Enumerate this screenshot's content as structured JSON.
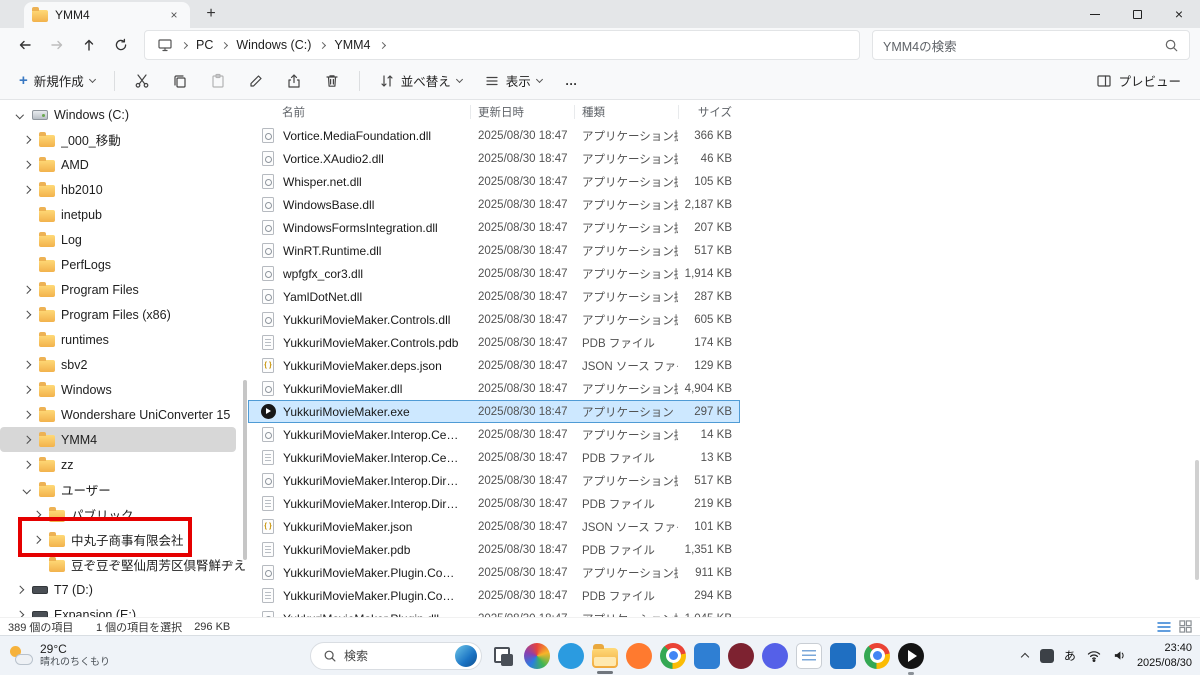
{
  "window": {
    "tab_title": "YMM4",
    "breadcrumb": [
      "PC",
      "Windows (C:)",
      "YMM4"
    ],
    "search_placeholder": "YMM4の検索"
  },
  "toolbar": {
    "new_label": "新規作成",
    "sort_label": "並べ替え",
    "view_label": "表示",
    "more_label": "…",
    "preview_label": "プレビュー"
  },
  "columns": [
    "名前",
    "更新日時",
    "種類",
    "サイズ"
  ],
  "sidebar": {
    "items": [
      {
        "id": "windows-c",
        "label": "Windows (C:)",
        "level": 0,
        "chevron": "down",
        "icon": "drive"
      },
      {
        "id": "000-idou",
        "label": "_000_移動",
        "level": 1,
        "chevron": "right",
        "icon": "folder"
      },
      {
        "id": "amd",
        "label": "AMD",
        "level": 1,
        "chevron": "right",
        "icon": "folder"
      },
      {
        "id": "hb2010",
        "label": "hb2010",
        "level": 1,
        "chevron": "right",
        "icon": "folder"
      },
      {
        "id": "inetpub",
        "label": "inetpub",
        "level": 1,
        "chevron": "none",
        "icon": "folder"
      },
      {
        "id": "log",
        "label": "Log",
        "level": 1,
        "chevron": "none",
        "icon": "folder"
      },
      {
        "id": "perflogs",
        "label": "PerfLogs",
        "level": 1,
        "chevron": "none",
        "icon": "folder"
      },
      {
        "id": "program-files",
        "label": "Program Files",
        "level": 1,
        "chevron": "right",
        "icon": "folder"
      },
      {
        "id": "program-files-x86",
        "label": "Program Files (x86)",
        "level": 1,
        "chevron": "right",
        "icon": "folder"
      },
      {
        "id": "runtimes",
        "label": "runtimes",
        "level": 1,
        "chevron": "none",
        "icon": "folder"
      },
      {
        "id": "sbv2",
        "label": "sbv2",
        "level": 1,
        "chevron": "right",
        "icon": "folder"
      },
      {
        "id": "windows",
        "label": "Windows",
        "level": 1,
        "chevron": "right",
        "icon": "folder"
      },
      {
        "id": "wondershare-uniconverter-15",
        "label": "Wondershare UniConverter 15",
        "level": 1,
        "chevron": "right",
        "icon": "folder"
      },
      {
        "id": "ymm4",
        "label": "YMM4",
        "level": 1,
        "chevron": "right",
        "icon": "folder",
        "selected": true
      },
      {
        "id": "zz",
        "label": "zz",
        "level": 1,
        "chevron": "right",
        "icon": "folder"
      },
      {
        "id": "users",
        "label": "ユーザー",
        "level": 1,
        "chevron": "down",
        "icon": "folder"
      },
      {
        "id": "public",
        "label": "パブリック",
        "level": 2,
        "chevron": "right",
        "icon": "folder"
      },
      {
        "id": "nakamaruko-shoji",
        "label": "中丸子商事有限会社",
        "level": 2,
        "chevron": "right",
        "icon": "folder",
        "annotated": true
      },
      {
        "id": "mojibake-user-folder",
        "label": "豆ぞ豆ぞ堅仙周芳区倶腎鮮ヂえ",
        "level": 2,
        "chevron": "none",
        "icon": "folder"
      },
      {
        "id": "t7-d",
        "label": "T7 (D:)",
        "level": 0,
        "chevron": "right",
        "icon": "drive-dark"
      },
      {
        "id": "expansion-e",
        "label": "Expansion (E:)",
        "level": 0,
        "chevron": "right",
        "icon": "drive-dark"
      }
    ]
  },
  "files": [
    {
      "name": "Vortice.MediaFoundation.dll",
      "modified": "2025/08/30 18:47",
      "type": "アプリケーション拡張",
      "size": "366 KB",
      "icon": "dll"
    },
    {
      "name": "Vortice.XAudio2.dll",
      "modified": "2025/08/30 18:47",
      "type": "アプリケーション拡張",
      "size": "46 KB",
      "icon": "dll"
    },
    {
      "name": "Whisper.net.dll",
      "modified": "2025/08/30 18:47",
      "type": "アプリケーション拡張",
      "size": "105 KB",
      "icon": "dll"
    },
    {
      "name": "WindowsBase.dll",
      "modified": "2025/08/30 18:47",
      "type": "アプリケーション拡張",
      "size": "2,187 KB",
      "icon": "dll"
    },
    {
      "name": "WindowsFormsIntegration.dll",
      "modified": "2025/08/30 18:47",
      "type": "アプリケーション拡張",
      "size": "207 KB",
      "icon": "dll"
    },
    {
      "name": "WinRT.Runtime.dll",
      "modified": "2025/08/30 18:47",
      "type": "アプリケーション拡張",
      "size": "517 KB",
      "icon": "dll"
    },
    {
      "name": "wpfgfx_cor3.dll",
      "modified": "2025/08/30 18:47",
      "type": "アプリケーション拡張",
      "size": "1,914 KB",
      "icon": "dll"
    },
    {
      "name": "YamlDotNet.dll",
      "modified": "2025/08/30 18:47",
      "type": "アプリケーション拡張",
      "size": "287 KB",
      "icon": "dll"
    },
    {
      "name": "YukkuriMovieMaker.Controls.dll",
      "modified": "2025/08/30 18:47",
      "type": "アプリケーション拡張",
      "size": "605 KB",
      "icon": "dll"
    },
    {
      "name": "YukkuriMovieMaker.Controls.pdb",
      "modified": "2025/08/30 18:47",
      "type": "PDB ファイル",
      "size": "174 KB",
      "icon": "pdb"
    },
    {
      "name": "YukkuriMovieMaker.deps.json",
      "modified": "2025/08/30 18:47",
      "type": "JSON ソース ファイル",
      "size": "129 KB",
      "icon": "json"
    },
    {
      "name": "YukkuriMovieMaker.dll",
      "modified": "2025/08/30 18:47",
      "type": "アプリケーション拡張",
      "size": "4,904 KB",
      "icon": "dll"
    },
    {
      "name": "YukkuriMovieMaker.exe",
      "modified": "2025/08/30 18:47",
      "type": "アプリケーション",
      "size": "297 KB",
      "icon": "exe",
      "selected": true
    },
    {
      "name": "YukkuriMovieMaker.Interop.CeVIO.dll",
      "modified": "2025/08/30 18:47",
      "type": "アプリケーション拡張",
      "size": "14 KB",
      "icon": "dll"
    },
    {
      "name": "YukkuriMovieMaker.Interop.CeVIO.pdb",
      "modified": "2025/08/30 18:47",
      "type": "PDB ファイル",
      "size": "13 KB",
      "icon": "pdb"
    },
    {
      "name": "YukkuriMovieMaker.Interop.DirectShow.dll",
      "modified": "2025/08/30 18:47",
      "type": "アプリケーション拡張",
      "size": "517 KB",
      "icon": "dll"
    },
    {
      "name": "YukkuriMovieMaker.Interop.DirectShow.p...",
      "modified": "2025/08/30 18:47",
      "type": "PDB ファイル",
      "size": "219 KB",
      "icon": "pdb"
    },
    {
      "name": "YukkuriMovieMaker.json",
      "modified": "2025/08/30 18:47",
      "type": "JSON ソース ファイル",
      "size": "101 KB",
      "icon": "json"
    },
    {
      "name": "YukkuriMovieMaker.pdb",
      "modified": "2025/08/30 18:47",
      "type": "PDB ファイル",
      "size": "1,351 KB",
      "icon": "pdb"
    },
    {
      "name": "YukkuriMovieMaker.Plugin.Community.dll",
      "modified": "2025/08/30 18:47",
      "type": "アプリケーション拡張",
      "size": "911 KB",
      "icon": "dll"
    },
    {
      "name": "YukkuriMovieMaker.Plugin.Community.pdb",
      "modified": "2025/08/30 18:47",
      "type": "PDB ファイル",
      "size": "294 KB",
      "icon": "pdb"
    },
    {
      "name": "YukkuriMovieMaker.Plugin.dll",
      "modified": "2025/08/30 18:47",
      "type": "アプリケーション拡張",
      "size": "1,045 KB",
      "icon": "dll"
    }
  ],
  "statusbar": {
    "items_count": "389 個の項目",
    "selection": "1 個の項目を選択",
    "selection_size": "296 KB"
  },
  "taskbar": {
    "weather_temp": "29°C",
    "weather_desc": "晴れのちくもり",
    "search_label": "検索",
    "ime": "あ",
    "clock_time": "23:40",
    "clock_date": "2025/08/30",
    "apps": [
      {
        "id": "task-view",
        "style": "taskview"
      },
      {
        "id": "photos",
        "style": "conic"
      },
      {
        "id": "edge",
        "style": "circle",
        "color": "#2b9be0"
      },
      {
        "id": "file-explorer",
        "style": "folder",
        "running": true,
        "active": true
      },
      {
        "id": "firefox",
        "style": "circle",
        "color": "#ff7a2f"
      },
      {
        "id": "chrome",
        "style": "chrome"
      },
      {
        "id": "microsoft-store",
        "style": "square",
        "color": "#2f7fd3"
      },
      {
        "id": "pinwheel-app",
        "style": "circle",
        "color": "#7d2230"
      },
      {
        "id": "discord",
        "style": "circle",
        "color": "#5560e8"
      },
      {
        "id": "notepad",
        "style": "notepad"
      },
      {
        "id": "outlook",
        "style": "square",
        "color": "#1f6fc2"
      },
      {
        "id": "chrome-2",
        "style": "chrome"
      },
      {
        "id": "yukkuri-movie-maker",
        "style": "play",
        "running": true
      }
    ]
  },
  "colors": {
    "selection_fill": "#cde8ff",
    "selection_border": "#4f9bd5",
    "sidebar_selected": "#d7d7d7",
    "annotation_red": "#e50000",
    "accent_blue": "#2f7fd6"
  }
}
